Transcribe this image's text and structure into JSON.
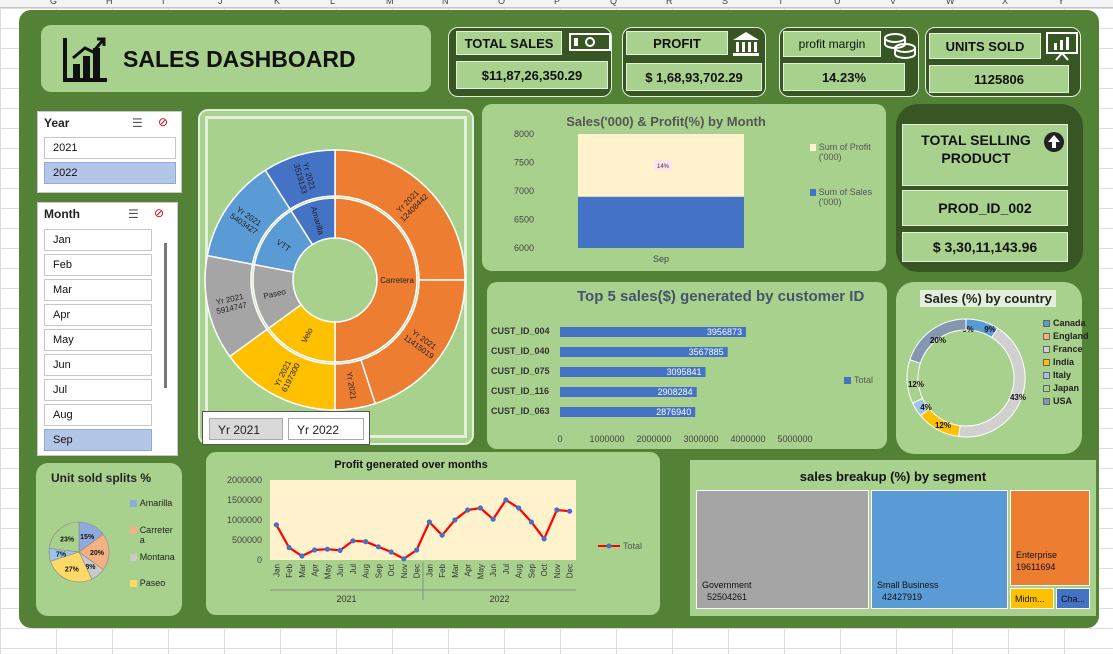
{
  "columns": [
    "G",
    "H",
    "I",
    "J",
    "K",
    "L",
    "M",
    "N",
    "O",
    "P",
    "Q",
    "R",
    "S",
    "T",
    "U",
    "V",
    "W",
    "X",
    "Y"
  ],
  "header": {
    "title": "SALES DASHBOARD",
    "total_sales_label": "TOTAL SALES",
    "total_sales_value": "$11,87,26,350.29",
    "profit_label": "PROFIT",
    "profit_value": "$ 1,68,93,702.29",
    "profit_margin_label": "profit margin",
    "profit_margin_value": "14.23%",
    "units_sold_label": "UNITS SOLD",
    "units_sold_value": "1125806"
  },
  "year_slicer": {
    "title": "Year",
    "items": [
      {
        "label": "2021",
        "selected": false
      },
      {
        "label": "2022",
        "selected": true
      }
    ]
  },
  "month_slicer": {
    "title": "Month",
    "items": [
      {
        "label": "Jan",
        "selected": false
      },
      {
        "label": "Feb",
        "selected": false
      },
      {
        "label": "Mar",
        "selected": false
      },
      {
        "label": "Apr",
        "selected": false
      },
      {
        "label": "May",
        "selected": false
      },
      {
        "label": "Jun",
        "selected": false
      },
      {
        "label": "Jul",
        "selected": false
      },
      {
        "label": "Aug",
        "selected": false
      },
      {
        "label": "Sep",
        "selected": true
      }
    ]
  },
  "sunburst": {
    "buttons": [
      "Yr 2021",
      "Yr 2022"
    ],
    "inner": [
      {
        "label": "Carretera",
        "value": 50,
        "color": "#ed7d31"
      },
      {
        "label": "Velo",
        "value": 15,
        "color": "#ffc000"
      },
      {
        "label": "Paseo",
        "value": 13,
        "color": "#a5a5a5"
      },
      {
        "label": "VTT",
        "value": 13,
        "color": "#5b9bd5"
      },
      {
        "label": "Amarilla",
        "value": 9,
        "color": "#4472c4"
      }
    ],
    "outer": [
      {
        "label": "Yr 2021\n12408442",
        "value": 25,
        "color": "#ed7d31"
      },
      {
        "label": "Yr 2021\n11415019",
        "value": 20,
        "color": "#ed7d31"
      },
      {
        "label": "Yr 2021",
        "value": 5,
        "color": "#ed7d31"
      },
      {
        "label": "Yr 2021\n6197300",
        "value": 15,
        "color": "#ffc000"
      },
      {
        "label": "Yr 2021\n5914747",
        "value": 13,
        "color": "#a5a5a5"
      },
      {
        "label": "Yr 2021\n5403427",
        "value": 13,
        "color": "#5b9bd5"
      },
      {
        "label": "Yr 2021\n3519133",
        "value": 9,
        "color": "#4472c4"
      }
    ]
  },
  "month_chart": {
    "title": "Sales('000) & Profit(%) by Month",
    "legend_profit": "Sum of Profit ('000)",
    "legend_sales": "Sum of Sales ('000)",
    "color_profit": "#fff2cc",
    "color_sales": "#4472c4"
  },
  "selling_product": {
    "title": "TOTAL SELLING PRODUCT",
    "product": "PROD_ID_002",
    "value": "$  3,30,11,143.96"
  },
  "top5_chart": {
    "title": "Top 5 sales($) generated by customer ID",
    "legend": "Total",
    "color": "#4472c4"
  },
  "country_chart": {
    "title": "Sales (%) by country"
  },
  "units_chart": {
    "title": "Unit sold splits %"
  },
  "profit_chart": {
    "title": "Profit generated over months",
    "legend": "Total",
    "years": [
      "2021",
      "2022"
    ],
    "months": [
      "Jan",
      "Feb",
      "Mar",
      "Apr",
      "May",
      "Jun",
      "Jul",
      "Aug",
      "Sep",
      "Oct",
      "Nov",
      "Dec"
    ],
    "line_color": "#ff0000",
    "marker_color": "#4472c4",
    "bg_color": "#fff2cc"
  },
  "segment_chart": {
    "title": "sales breakup (%) by segment"
  },
  "chart_data": [
    {
      "type": "bar",
      "title": "Sales('000) & Profit(%) by Month",
      "categories": [
        "Sep"
      ],
      "series": [
        {
          "name": "Sum of Sales ('000)",
          "values": [
            6900
          ]
        },
        {
          "name": "Sum of Profit ('000)",
          "values": [
            1100
          ]
        }
      ],
      "stacked": true,
      "data_labels": [
        "14%"
      ],
      "ylim": [
        6000,
        8000
      ],
      "yticks": [
        6000,
        6500,
        7000,
        7500,
        8000
      ]
    },
    {
      "type": "bar",
      "orientation": "horizontal",
      "title": "Top 5 sales($) generated by customer ID",
      "categories": [
        "CUST_ID_004",
        "CUST_ID_040",
        "CUST_ID_075",
        "CUST_ID_116",
        "CUST_ID_063"
      ],
      "series": [
        {
          "name": "Total",
          "values": [
            3956873,
            3567885,
            3095841,
            2908284,
            2876940
          ]
        }
      ],
      "xlim": [
        0,
        5000000
      ],
      "xticks": [
        0,
        1000000,
        2000000,
        3000000,
        4000000,
        5000000
      ]
    },
    {
      "type": "pie",
      "donut": true,
      "title": "Sales (%) by country",
      "categories": [
        "Canada",
        "England",
        "France",
        "India",
        "Italy",
        "Japan",
        "USA"
      ],
      "values": [
        9,
        0,
        43,
        12,
        4,
        12,
        20
      ],
      "labels": [
        "9%",
        "0%",
        "43%",
        "12%",
        "4%",
        "12%",
        "20%"
      ],
      "colors": [
        "#5b9bd5",
        "#f4b183",
        "#d0d0d0",
        "#ffc000",
        "#9dc3e6",
        "#a9d18e",
        "#8497b0"
      ]
    },
    {
      "type": "pie",
      "title": "Unit sold splits %",
      "categories": [
        "Amarilla",
        "Carretera",
        "Montana",
        "Paseo",
        "VTT",
        "Velo"
      ],
      "values": [
        15,
        20,
        8,
        27,
        7,
        23
      ],
      "labels": [
        "15%",
        "20%",
        "8%",
        "27%",
        "7%",
        "23%"
      ],
      "legend": [
        "Amarilla",
        "Carretera",
        "Montana",
        "Paseo"
      ],
      "colors": [
        "#8faadc",
        "#f4b183",
        "#c9c9c9",
        "#ffd966",
        "#9dc3e6",
        "#a9d18e"
      ]
    },
    {
      "type": "line",
      "title": "Profit generated over months",
      "x": [
        "Jan",
        "Feb",
        "Mar",
        "Apr",
        "May",
        "Jun",
        "Jul",
        "Aug",
        "Sep",
        "Oct",
        "Nov",
        "Dec",
        "Jan",
        "Feb",
        "Mar",
        "Apr",
        "May",
        "Jun",
        "Jul",
        "Aug",
        "Sep",
        "Oct",
        "Nov",
        "Dec"
      ],
      "x_groups": [
        "2021",
        "2022"
      ],
      "series": [
        {
          "name": "Total",
          "values": [
            880000,
            310000,
            100000,
            250000,
            270000,
            240000,
            480000,
            460000,
            330000,
            200000,
            30000,
            250000,
            950000,
            620000,
            1000000,
            1250000,
            1300000,
            1020000,
            1500000,
            1300000,
            950000,
            530000,
            1250000,
            1220000
          ]
        }
      ],
      "ylim": [
        0,
        2000000
      ],
      "yticks": [
        0,
        500000,
        1000000,
        1500000,
        2000000
      ]
    },
    {
      "type": "treemap",
      "title": "sales breakup (%) by segment",
      "categories": [
        "Government",
        "Small Business",
        "Enterprise",
        "Midmarket",
        "Channel Partners"
      ],
      "labels": [
        "Government",
        "Small Business",
        "Enterprise",
        "Midm...",
        "Cha..."
      ],
      "values": [
        52504261,
        42427919,
        19611694,
        5000000,
        3000000
      ],
      "colors": [
        "#a5a5a5",
        "#5b9bd5",
        "#ed7d31",
        "#ffc000",
        "#4472c4"
      ]
    }
  ]
}
